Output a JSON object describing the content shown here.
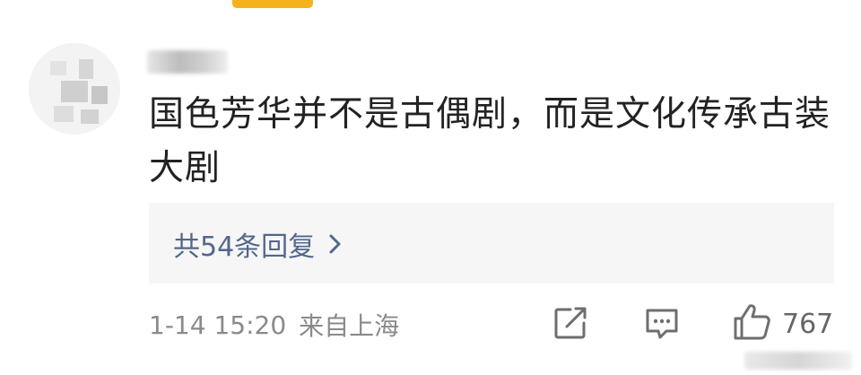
{
  "comment": {
    "text": "国色芳华并不是古偶剧，而是文化传承古装大剧",
    "reply_count_label": "共54条回复",
    "timestamp": "1-14 15:20",
    "location": "来自上海",
    "likes": "767"
  },
  "icons": {
    "share": "share-icon",
    "comment": "comment-icon",
    "like": "thumbs-up-icon",
    "chevron": "chevron-right-icon"
  },
  "colors": {
    "accent_bar": "#f6b21b",
    "reply_link": "#52678a",
    "meta_text": "#8a8a8a",
    "reply_bg": "#f6f6f6"
  }
}
